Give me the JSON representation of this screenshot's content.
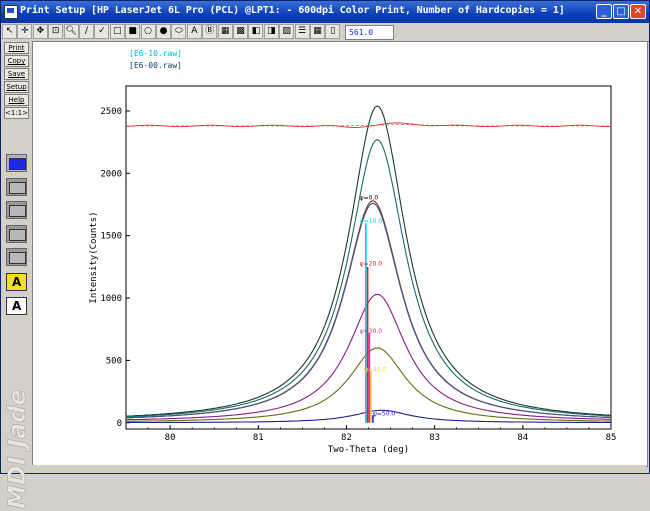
{
  "window": {
    "title": "Print Setup [HP LaserJet 6L Pro (PCL) @LPT1: - 600dpi Color Print, Number of Hardcopies = 1]"
  },
  "toolbar": {
    "zoom_value": "561.0",
    "icons": [
      "arrow-icon",
      "crosshair-icon",
      "move-icon",
      "pan-icon",
      "zoom-icon",
      "line-icon",
      "check-icon",
      "rect-icon",
      "fill-rect-icon",
      "circle-icon",
      "fill-circle-icon",
      "ellipse-icon",
      "text-icon",
      "b-icon",
      "table-icon",
      "grid-icon",
      "half-icon",
      "bw-icon",
      "color-icon",
      "list-icon",
      "grid2-icon",
      "tag-icon"
    ]
  },
  "sidebar": {
    "buttons": [
      "Print",
      "Copy",
      "Save",
      "Setup",
      "Help",
      "<1:1>"
    ],
    "logo_text": "MDI Jade"
  },
  "legend": {
    "file1": "[E6-10.raw]",
    "file2": "[E6-00.raw]"
  },
  "chart_data": {
    "type": "line",
    "xlabel": "Two-Theta (deg)",
    "ylabel": "Intensity(Counts)",
    "xlim": [
      79.5,
      85
    ],
    "ylim": [
      -50,
      2700
    ],
    "xticks": [
      80,
      81,
      82,
      83,
      84,
      85
    ],
    "yticks": [
      0,
      500,
      1000,
      1500,
      2000,
      2500
    ],
    "series": [
      {
        "name": "ψ=0.0",
        "color": "#1a3a2a",
        "peak_x": 82.35,
        "peak_y": 2540,
        "base": 5
      },
      {
        "name": "",
        "color": "#1a6a6a",
        "peak_x": 82.35,
        "peak_y": 2270,
        "base": 5
      },
      {
        "name": "ψ=10.0",
        "color": "#8b2a2a",
        "peak_x": 82.3,
        "peak_y": 1780,
        "base": 5
      },
      {
        "name": "ψ=20.0",
        "color": "#3a5a8a",
        "peak_x": 82.3,
        "peak_y": 1760,
        "base": 5
      },
      {
        "name": "ψ=30.0",
        "color": "#8a1a8a",
        "peak_x": 82.35,
        "peak_y": 1030,
        "base": 5
      },
      {
        "name": "ψ=40.0",
        "color": "#6a6a10",
        "peak_x": 82.35,
        "peak_y": 600,
        "base": 0
      },
      {
        "name": "ψ=50.0",
        "color": "#202090",
        "peak_x": 82.4,
        "peak_y": 100,
        "base": 0
      },
      {
        "name": "",
        "color": "#e03030",
        "flat_y": 2380
      }
    ],
    "peak_labels": [
      {
        "text": "ψ=0.0",
        "x": 82.15,
        "y": 1790,
        "color": "#000000"
      },
      {
        "text": "ψ=10.0",
        "x": 82.15,
        "y": 1600,
        "color": "#00c8e0"
      },
      {
        "text": "ψ=20.0",
        "x": 82.15,
        "y": 1260,
        "color": "#e02020"
      },
      {
        "text": "ψ=30.0",
        "x": 82.15,
        "y": 720,
        "color": "#e020e0"
      },
      {
        "text": "ψ=40.0",
        "x": 82.2,
        "y": 410,
        "color": "#e8e020"
      },
      {
        "text": "ψ=50.0",
        "x": 82.3,
        "y": 60,
        "color": "#2020e0"
      }
    ],
    "marker_lines": [
      {
        "x": 82.22,
        "y_top": 1600,
        "color": "#00c8e0"
      },
      {
        "x": 82.24,
        "y_top": 1250,
        "color": "#e02020"
      },
      {
        "x": 82.26,
        "y_top": 720,
        "color": "#e020e0"
      },
      {
        "x": 82.28,
        "y_top": 410,
        "color": "#e8e020"
      },
      {
        "x": 82.3,
        "y_top": 60,
        "color": "#2020e0"
      }
    ]
  }
}
